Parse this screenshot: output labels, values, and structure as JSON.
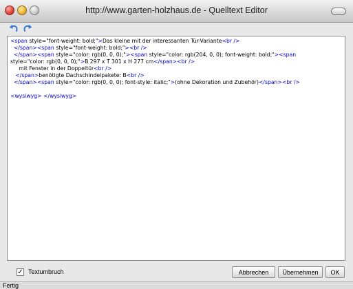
{
  "window": {
    "title": "http://www.garten-holzhaus.de - Quelltext Editor"
  },
  "toolbar": {
    "undo_icon": "undo-arrow-icon",
    "redo_icon": "redo-arrow-icon",
    "icon_color": "#3a74d8"
  },
  "editor": {
    "lines": [
      [
        {
          "t": "tag",
          "v": "<span "
        },
        {
          "t": "attr",
          "v": "style="
        },
        {
          "t": "str",
          "v": "\"font-weight: bold;\""
        },
        {
          "t": "tag",
          "v": ">"
        },
        {
          "t": "txt",
          "v": "Das kleine mit der interessanten Tür-Variante"
        },
        {
          "t": "tag",
          "v": "<br />"
        }
      ],
      [
        {
          "t": "txt",
          "v": "  "
        },
        {
          "t": "tag",
          "v": "</span>"
        },
        {
          "t": "tag",
          "v": "<span "
        },
        {
          "t": "attr",
          "v": "style="
        },
        {
          "t": "str",
          "v": "\"font-weight: bold;\""
        },
        {
          "t": "tag",
          "v": ">"
        },
        {
          "t": "tag",
          "v": "<br />"
        }
      ],
      [
        {
          "t": "txt",
          "v": "  "
        },
        {
          "t": "tag",
          "v": "</span>"
        },
        {
          "t": "tag",
          "v": "<span "
        },
        {
          "t": "attr",
          "v": "style="
        },
        {
          "t": "str",
          "v": "\"color: rgb(0, 0, 0);\""
        },
        {
          "t": "tag",
          "v": ">"
        },
        {
          "t": "tag",
          "v": "<span "
        },
        {
          "t": "attr",
          "v": "style="
        },
        {
          "t": "str",
          "v": "\"color: rgb(204, 0, 0); font-weight: bold;\""
        },
        {
          "t": "tag",
          "v": ">"
        },
        {
          "t": "tag",
          "v": "<span"
        }
      ],
      [
        {
          "t": "attr",
          "v": "style="
        },
        {
          "t": "str",
          "v": "\"color: rgb(0, 0, 0);\""
        },
        {
          "t": "tag",
          "v": ">"
        },
        {
          "t": "txt",
          "v": "B 297 x T 301 x H 277 cm"
        },
        {
          "t": "tag",
          "v": "</span>"
        },
        {
          "t": "tag",
          "v": "<br />"
        }
      ],
      [
        {
          "t": "txt",
          "v": "     mit Fenster in der Doppeltür"
        },
        {
          "t": "tag",
          "v": "<br />"
        }
      ],
      [
        {
          "t": "txt",
          "v": "   "
        },
        {
          "t": "tag",
          "v": "</span>"
        },
        {
          "t": "txt",
          "v": "benötigte Dachschindelpakete: B"
        },
        {
          "t": "tag",
          "v": "<br />"
        }
      ],
      [
        {
          "t": "txt",
          "v": "  "
        },
        {
          "t": "tag",
          "v": "</span>"
        },
        {
          "t": "tag",
          "v": "<span "
        },
        {
          "t": "attr",
          "v": "style="
        },
        {
          "t": "str",
          "v": "\"color: rgb(0, 0, 0); font-style: italic;\""
        },
        {
          "t": "tag",
          "v": ">"
        },
        {
          "t": "txt",
          "v": "(ohne Dekoration und Zubehör)"
        },
        {
          "t": "tag",
          "v": "</span>"
        },
        {
          "t": "tag",
          "v": "<br />"
        }
      ],
      [],
      [
        {
          "t": "tag",
          "v": "<wysiwyg>"
        },
        {
          "t": "txt",
          "v": " "
        },
        {
          "t": "tag",
          "v": "</wysiwyg>"
        }
      ]
    ]
  },
  "options": {
    "wrap_label": "Textumbruch",
    "wrap_checked_mark": "✓"
  },
  "buttons": {
    "cancel_label": "Abbrechen",
    "apply_label": "Übernehmen",
    "ok_label": "OK"
  },
  "status": {
    "text": "Fertig"
  }
}
